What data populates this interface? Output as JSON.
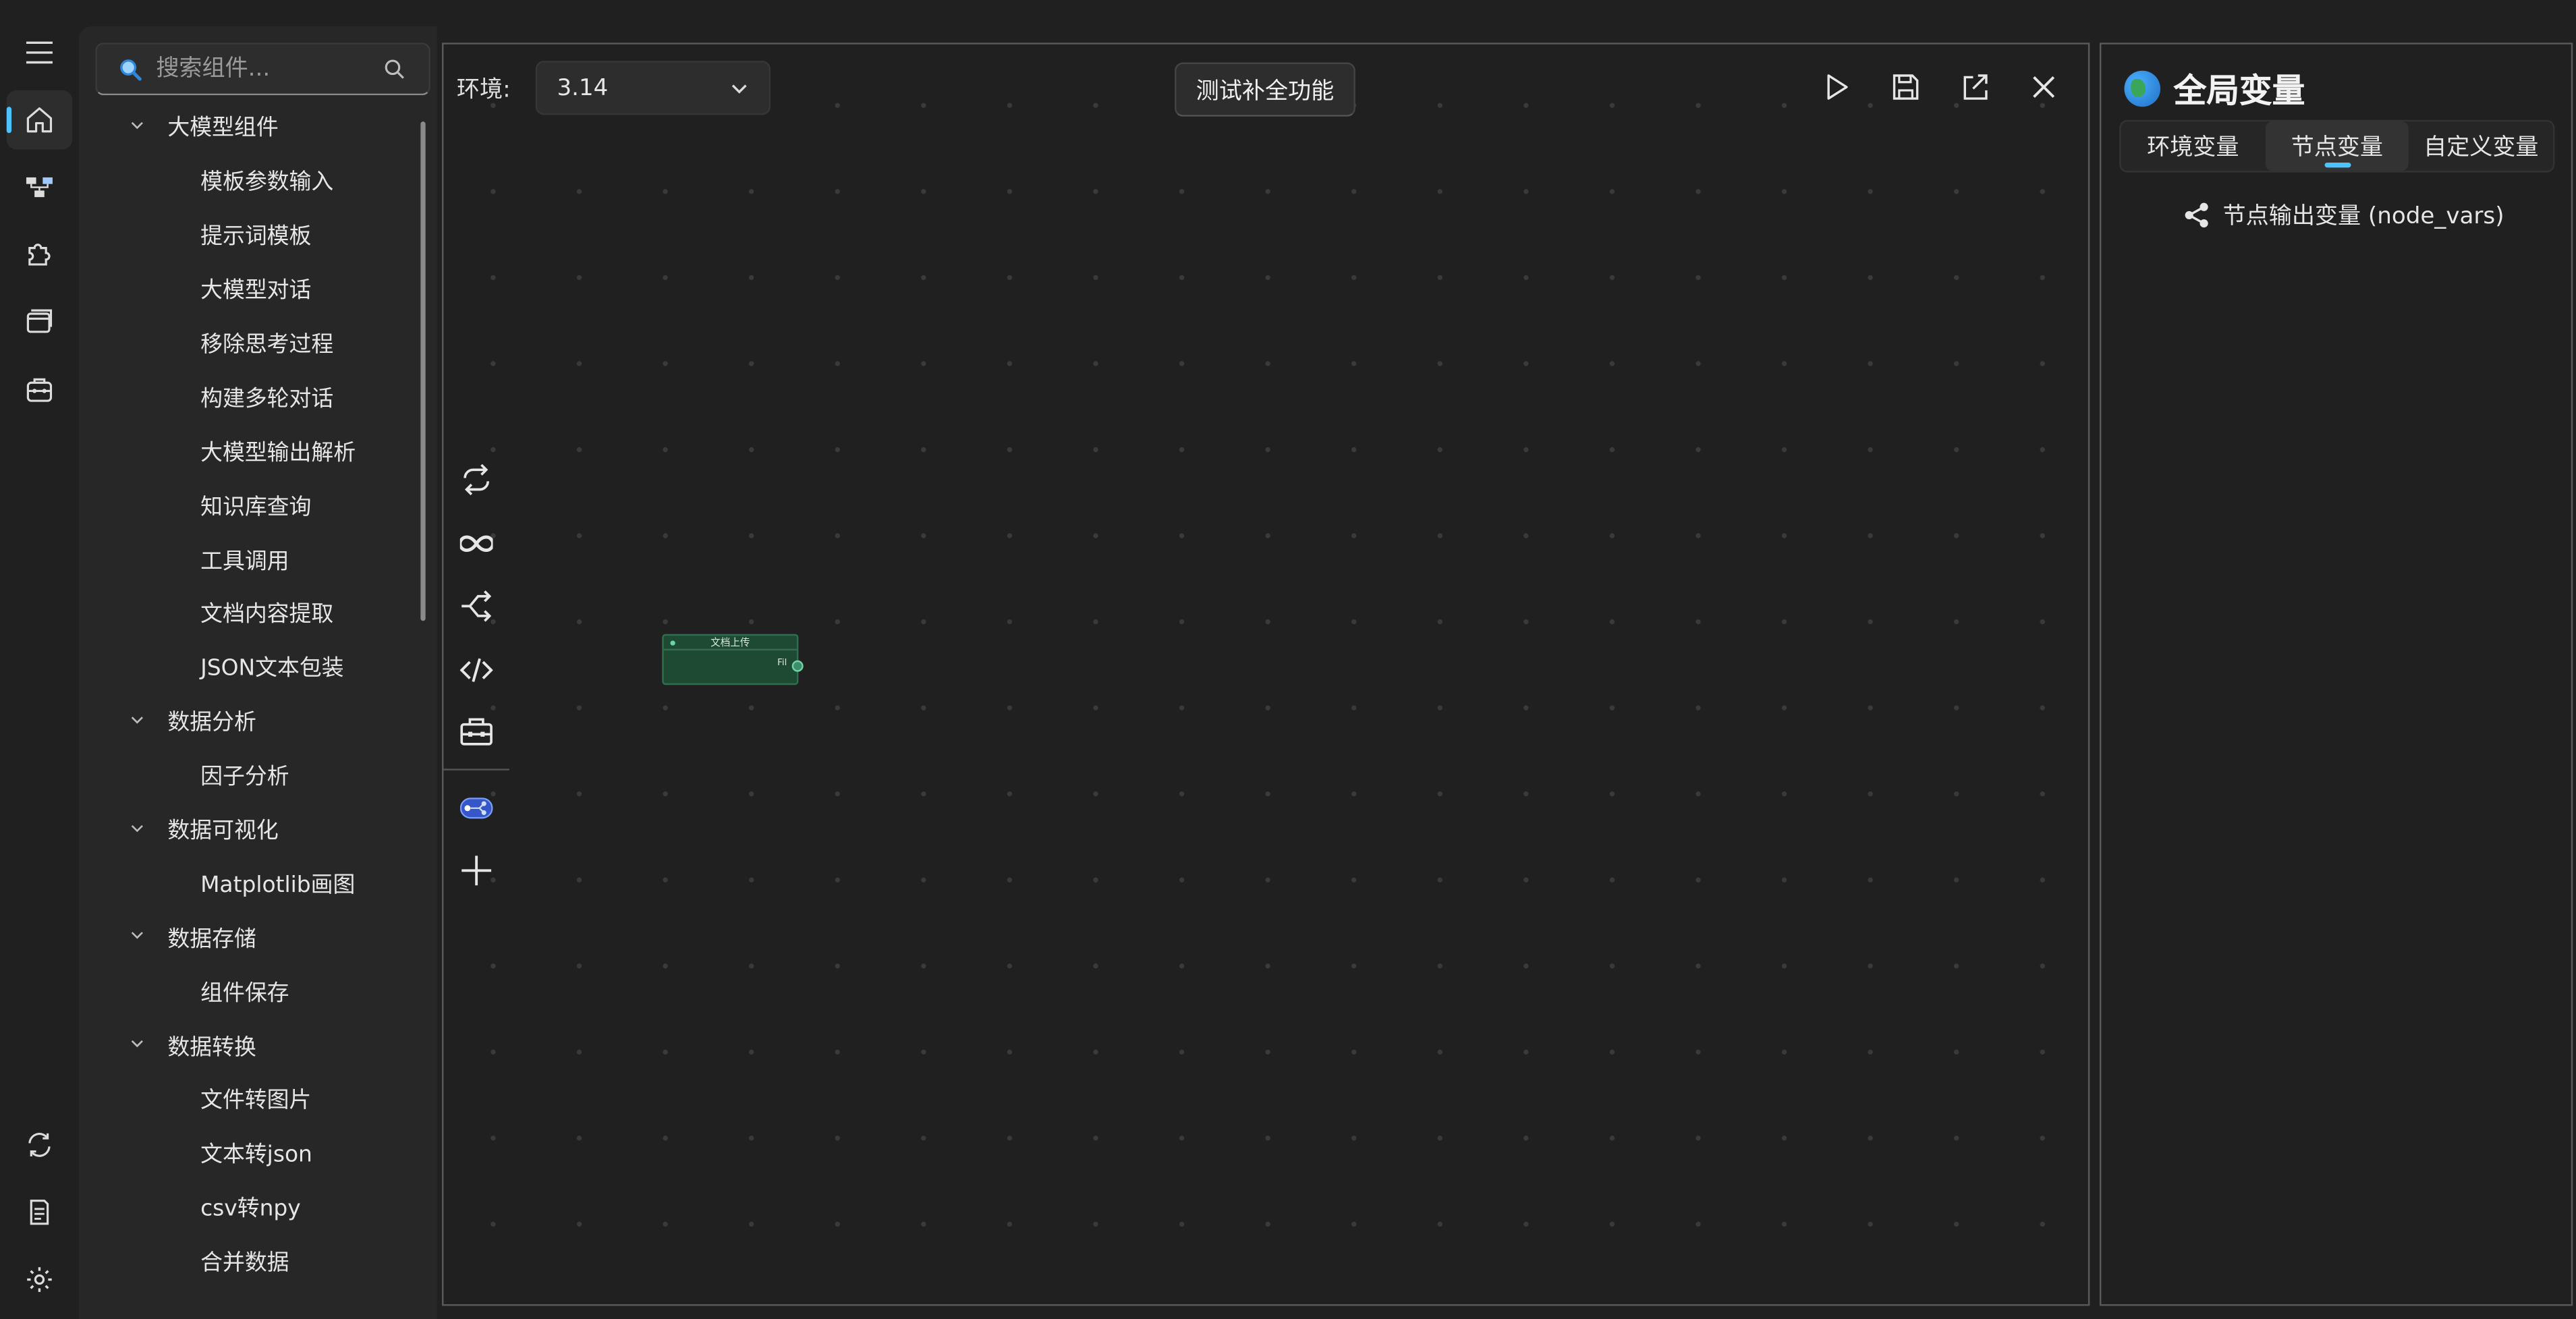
{
  "rail": {
    "top_items": [
      {
        "name": "home-icon",
        "active": true
      },
      {
        "name": "flow-icon",
        "active": false
      },
      {
        "name": "puzzle-icon",
        "active": false
      },
      {
        "name": "window-icon",
        "active": false
      },
      {
        "name": "toolbox-icon",
        "active": false
      }
    ],
    "bottom_items": [
      {
        "name": "sync-icon"
      },
      {
        "name": "log-icon"
      },
      {
        "name": "settings-icon"
      }
    ]
  },
  "components": {
    "search_placeholder": "搜索组件...",
    "tree": [
      {
        "type": "group",
        "label": "大模型组件"
      },
      {
        "type": "leaf",
        "label": "模板参数输入"
      },
      {
        "type": "leaf",
        "label": "提示词模板"
      },
      {
        "type": "leaf",
        "label": "大模型对话"
      },
      {
        "type": "leaf",
        "label": "移除思考过程"
      },
      {
        "type": "leaf",
        "label": "构建多轮对话"
      },
      {
        "type": "leaf",
        "label": "大模型输出解析"
      },
      {
        "type": "leaf",
        "label": "知识库查询"
      },
      {
        "type": "leaf",
        "label": "工具调用"
      },
      {
        "type": "leaf",
        "label": "文档内容提取"
      },
      {
        "type": "leaf",
        "label": "JSON文本包装"
      },
      {
        "type": "group",
        "label": "数据分析"
      },
      {
        "type": "leaf",
        "label": "因子分析"
      },
      {
        "type": "group",
        "label": "数据可视化"
      },
      {
        "type": "leaf",
        "label": "Matplotlib画图"
      },
      {
        "type": "group",
        "label": "数据存储"
      },
      {
        "type": "leaf",
        "label": "组件保存"
      },
      {
        "type": "group",
        "label": "数据转换"
      },
      {
        "type": "leaf",
        "label": "文件转图片"
      },
      {
        "type": "leaf",
        "label": "文本转json"
      },
      {
        "type": "leaf",
        "label": "csv转npy"
      },
      {
        "type": "leaf",
        "label": "合并数据"
      }
    ]
  },
  "canvas": {
    "env_label": "环境:",
    "env_value": "3.14",
    "test_button": "测试补全功能",
    "node": {
      "title": "文档上传",
      "output": "Fil"
    }
  },
  "global_vars": {
    "title": "全局变量",
    "tabs": [
      "环境变量",
      "节点变量",
      "自定义变量"
    ],
    "active_tab": 1,
    "node_vars_label": "节点输出变量 (node_vars)"
  }
}
